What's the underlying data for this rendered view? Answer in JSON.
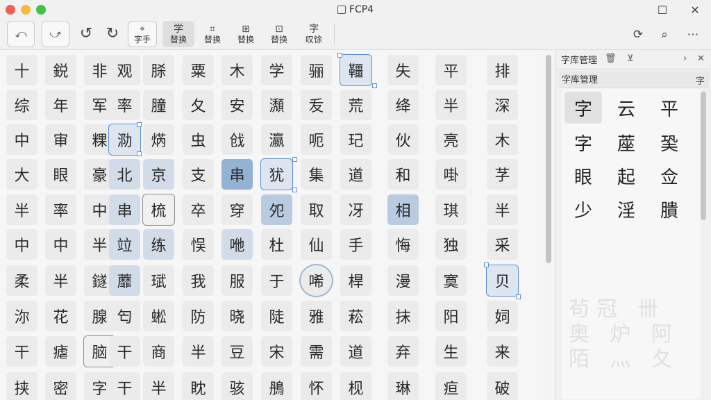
{
  "window": {
    "title": "FCP4"
  },
  "toolbar": {
    "items": [
      {
        "name": "undo-arrow-button",
        "icon": "⤺",
        "label": ""
      },
      {
        "name": "redo-arrow-button",
        "icon": "⤻",
        "label": ""
      },
      {
        "name": "rotate-left-button",
        "icon": "↺",
        "label": ""
      },
      {
        "name": "rotate-right-button",
        "icon": "↻",
        "label": ""
      },
      {
        "name": "char-button",
        "icon": "⌖",
        "label": "字手"
      },
      {
        "name": "replace-button-1",
        "icon": "学",
        "label": "替换"
      },
      {
        "name": "replace-button-2",
        "icon": "⌗",
        "label": "替换"
      },
      {
        "name": "replace-button-3",
        "icon": "⊞",
        "label": "替换"
      },
      {
        "name": "replace-button-4",
        "icon": "⊡",
        "label": "替换"
      },
      {
        "name": "char-practice-button",
        "icon": "字",
        "label": "叹馀"
      }
    ],
    "right_icons": [
      "refresh-icon",
      "search-icon",
      "more-icon"
    ]
  },
  "grid": {
    "rows": [
      [
        "十",
        "鋭",
        "非",
        "观",
        "脎",
        "粟",
        "木",
        "学",
        "骊",
        "韁",
        "失",
        "平",
        "排"
      ],
      [
        "综",
        "年",
        "军",
        "率",
        "膧",
        "夂",
        "安",
        "瀩",
        "叐",
        "荒",
        "绛",
        "半",
        "深"
      ],
      [
        "中",
        "审",
        "粿",
        "泐",
        "焫",
        "虫",
        "戗",
        "瀛",
        "呃",
        "玘",
        "伙",
        "亮",
        "木"
      ],
      [
        "大",
        "眼",
        "豪",
        "北",
        "京",
        "支",
        "串",
        "犹",
        "集",
        "道",
        "和",
        "啩",
        "芓"
      ],
      [
        "半",
        "率",
        "中",
        "串",
        "梳",
        "卒",
        "穿",
        "夗",
        "取",
        "冴",
        "相",
        "琪",
        "半"
      ],
      [
        "中",
        "中",
        "半",
        "竝",
        "练",
        "悮",
        "咃",
        "杜",
        "仙",
        "手",
        "悔",
        "独",
        "采"
      ],
      [
        "柔",
        "半",
        "鐩",
        "蘼",
        "珷",
        "我",
        "服",
        "于",
        "唏",
        "桿",
        "漫",
        "寞",
        "贝"
      ],
      [
        "沵",
        "花",
        "腺",
        "匄",
        "蜙",
        "防",
        "晓",
        "陡",
        "雅",
        "菘",
        "抹",
        "阳",
        "㚸"
      ],
      [
        "干",
        "瘧",
        "脑",
        "干",
        "商",
        "半",
        "豆",
        "宋",
        "需",
        "道",
        "弃",
        "生",
        "来"
      ],
      [
        "挟",
        "密",
        "字",
        "干",
        "半",
        "眈",
        "骇",
        "鴅",
        "怀",
        "枧",
        "琳",
        "疸",
        "破"
      ]
    ]
  },
  "panel": {
    "tab_label": "字库管理",
    "sub_label": "字库管理",
    "sub_icon": "字",
    "chars": [
      [
        "字",
        "云",
        "平"
      ],
      [
        "字",
        "蓙",
        "㠫"
      ],
      [
        "眼",
        "起",
        "佥"
      ],
      [
        "少",
        "淫",
        "膭"
      ]
    ],
    "ghost_text": "茍冠 卌 奥 炉 阿 陌 灬 夂"
  }
}
